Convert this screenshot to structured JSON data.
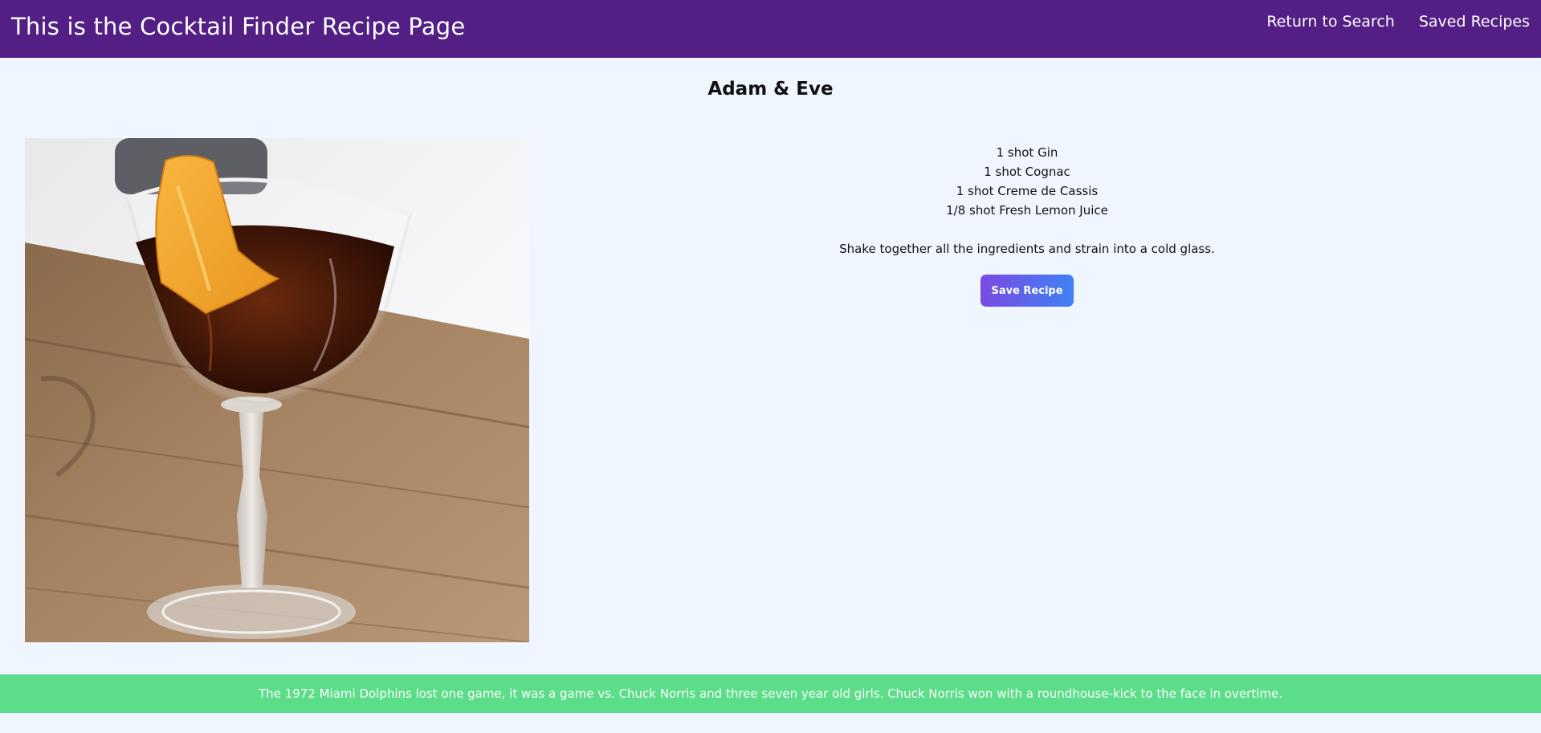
{
  "header": {
    "title": "This is the Cocktail Finder Recipe Page",
    "nav": {
      "return_to_search": "Return to Search",
      "saved_recipes": "Saved Recipes"
    },
    "background_color": "#531f85"
  },
  "recipe": {
    "name": "Adam & Eve",
    "image_alt": "Adam & Eve cocktail with orange peel garnish",
    "ingredients": [
      "1 shot Gin",
      "1 shot Cognac",
      "1 shot Creme de Cassis",
      "1/8 shot Fresh Lemon Juice"
    ],
    "instructions": "Shake together all the ingredients and strain into a cold glass.",
    "save_label": "Save Recipe"
  },
  "footer": {
    "fact": "The 1972 Miami Dolphins lost one game, it was a game vs. Chuck Norris and three seven year old girls. Chuck Norris won with a roundhouse-kick to the face in overtime.",
    "background_color": "#5bdd89"
  }
}
